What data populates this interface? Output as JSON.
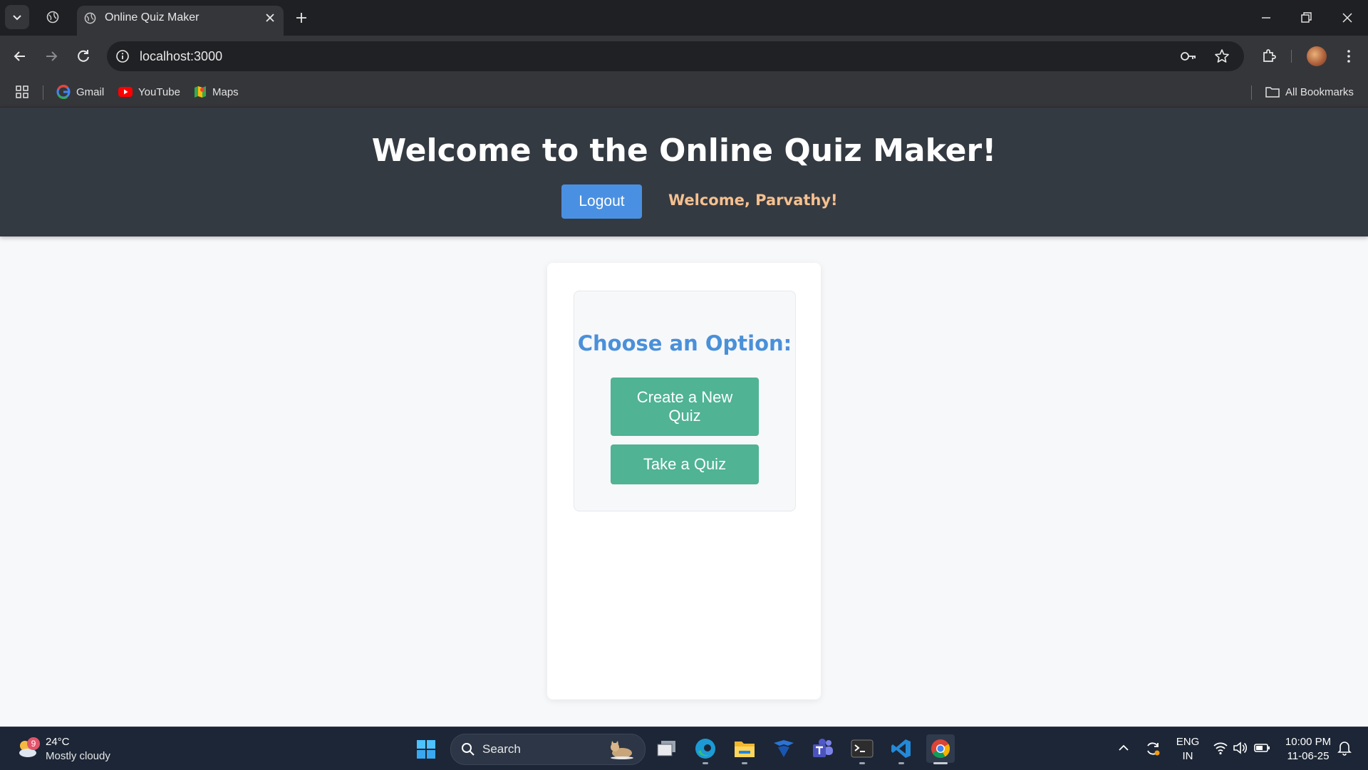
{
  "browser": {
    "tab_title": "Online Quiz Maker",
    "url": "localhost:3000",
    "bookmarks": [
      {
        "label": "Gmail",
        "icon": "gmail-icon"
      },
      {
        "label": "YouTube",
        "icon": "youtube-icon"
      },
      {
        "label": "Maps",
        "icon": "maps-icon"
      }
    ],
    "all_bookmarks_label": "All Bookmarks"
  },
  "header": {
    "title": "Welcome to the Online Quiz Maker!",
    "logout_label": "Logout",
    "welcome_user": "Welcome, Parvathy!"
  },
  "main": {
    "heading": "Choose an Option:",
    "create_label": "Create a New Quiz",
    "take_label": "Take a Quiz"
  },
  "taskbar": {
    "weather_badge": "9",
    "temperature": "24°C",
    "condition": "Mostly cloudy",
    "search_label": "Search",
    "language": "ENG",
    "region": "IN",
    "time": "10:00 PM",
    "date": "11-06-25"
  },
  "colors": {
    "header_bg": "#343a42",
    "accent_blue": "#4a90e2",
    "option_green": "#4fb394",
    "welcome_orange": "#f5c08f"
  }
}
